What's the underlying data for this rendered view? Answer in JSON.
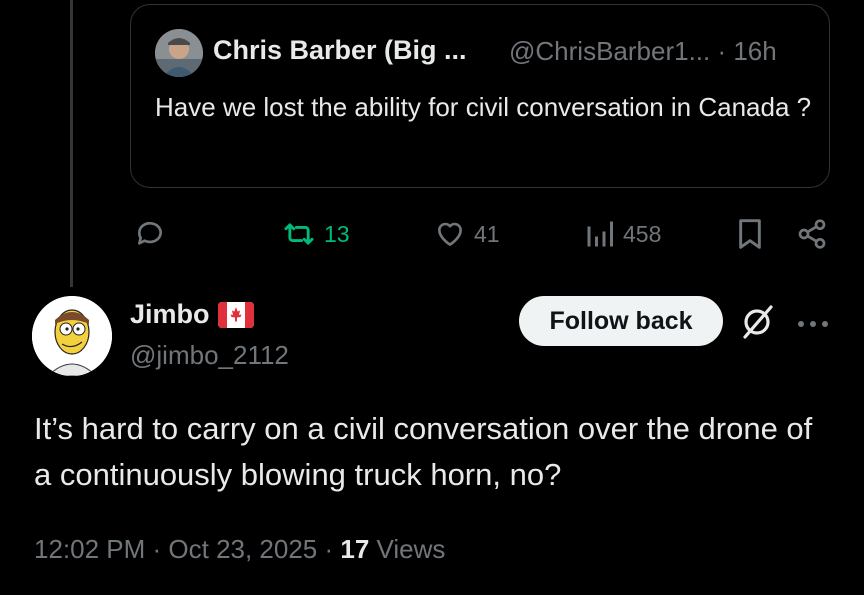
{
  "quoted_post": {
    "author_name": "Chris Barber (Big ...",
    "handle_time": "@ChrisBarber1... · 16h",
    "text": "Have we lost the ability for civil conversation in Canada ?"
  },
  "actions": {
    "retweets": "13",
    "likes": "41",
    "views": "458"
  },
  "reply": {
    "author_name": "Jimbo",
    "flag": "canada-flag",
    "handle": "@jimbo_2112",
    "follow_label": "Follow back",
    "text": "It’s hard to carry on a civil conversation over the drone of a continuously blowing truck horn, no?",
    "time_date": "12:02 PM · Oct 23, 2025 · ",
    "views_count": "17",
    "views_label": " Views"
  },
  "colors": {
    "background": "#000000",
    "text_primary": "#e7e9ea",
    "text_secondary": "#71767b",
    "retweet_active": "#00ba7c",
    "border": "#2f3336",
    "button_bg": "#eff3f4"
  }
}
